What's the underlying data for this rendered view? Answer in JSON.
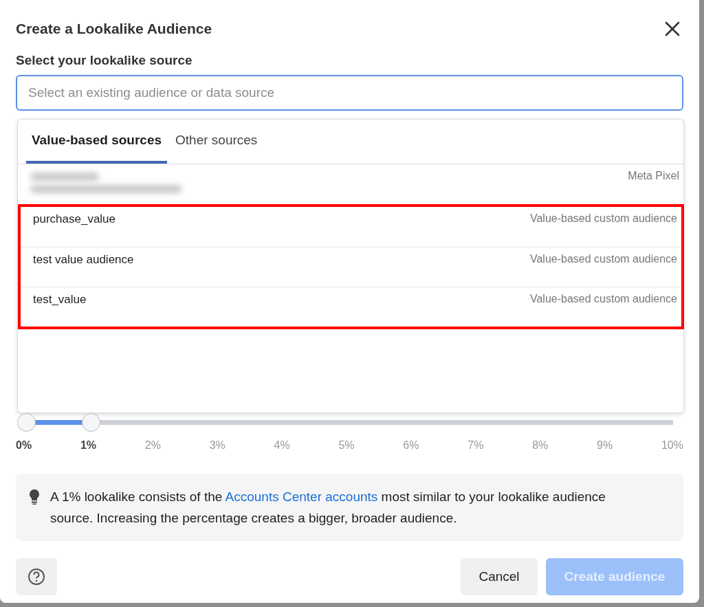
{
  "dialog": {
    "title": "Create a Lookalike Audience",
    "source_label": "Select your lookalike source",
    "search": {
      "placeholder": "Select an existing audience or data source"
    }
  },
  "dropdown": {
    "tabs": [
      {
        "label": "Value-based sources",
        "selected": true
      },
      {
        "label": "Other sources",
        "selected": false
      }
    ],
    "items": [
      {
        "kind": "redacted",
        "type": "Meta Pixel",
        "highlighted": false
      },
      {
        "kind": "named",
        "name": "purchase_value",
        "type": "Value-based custom audience",
        "highlighted": true
      },
      {
        "kind": "named",
        "name": "test value audience",
        "type": "Value-based custom audience",
        "highlighted": true
      },
      {
        "kind": "named",
        "name": "test_value",
        "type": "Value-based custom audience",
        "highlighted": true
      }
    ]
  },
  "slider": {
    "level": 0.1,
    "ticks": [
      {
        "label": "0%",
        "selected": true
      },
      {
        "label": "1%",
        "selected": true
      },
      {
        "label": "2%",
        "selected": false
      },
      {
        "label": "3%",
        "selected": false
      },
      {
        "label": "4%",
        "selected": false
      },
      {
        "label": "5%",
        "selected": false
      },
      {
        "label": "6%",
        "selected": false
      },
      {
        "label": "7%",
        "selected": false
      },
      {
        "label": "8%",
        "selected": false
      },
      {
        "label": "9%",
        "selected": false
      },
      {
        "label": "10%",
        "selected": false
      }
    ]
  },
  "info": {
    "before": "A 1% lookalike consists of the ",
    "link": "Accounts Center accounts",
    "after": " most similar to your lookalike audience source. Increasing the percentage creates a bigger, broader audience."
  },
  "footer": {
    "cancel": "Cancel",
    "create": {
      "label": "Create audience",
      "disabled": true
    }
  }
}
